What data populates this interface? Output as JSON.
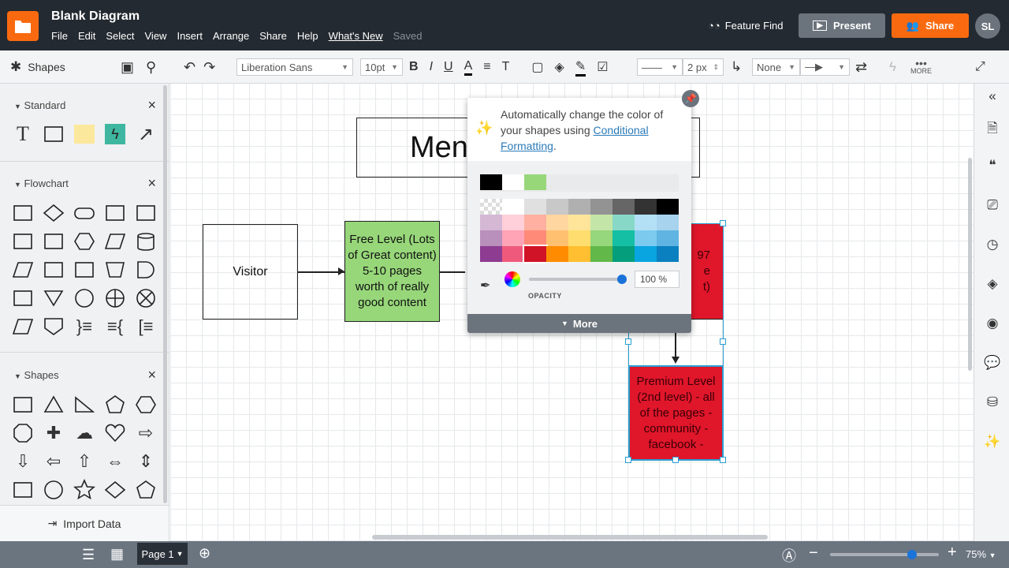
{
  "app": {
    "title": "Blank Diagram",
    "menu": [
      "File",
      "Edit",
      "Select",
      "View",
      "Insert",
      "Arrange",
      "Share",
      "Help"
    ],
    "whats_new": "What's New",
    "saved": "Saved",
    "feature_find": "Feature Find",
    "present": "Present",
    "share": "Share",
    "avatar": "SL",
    "brand_color": "#f96a10"
  },
  "toolbar": {
    "shapes_label": "Shapes",
    "font": "Liberation Sans",
    "font_size": "10pt",
    "line_width": "2 px",
    "line_start": "None",
    "more": "MORE"
  },
  "left": {
    "sections": [
      {
        "title": "Standard",
        "shapes": [
          "text-icon",
          "rectangle-icon",
          "note-icon",
          "action-icon",
          "arrow-line-icon"
        ]
      },
      {
        "title": "Flowchart",
        "shapes": [
          "process-icon",
          "decision-icon",
          "terminator-icon",
          "predefined-process-icon",
          "document-icon",
          "internal-storage-icon",
          "manual-input-icon",
          "preparation-icon",
          "data-icon",
          "database-icon",
          "direct-data-icon",
          "display-icon",
          "tape-icon",
          "manual-operation-icon",
          "delay-icon",
          "card-icon",
          "merge-icon",
          "connector-icon",
          "or-icon",
          "summing-junction-icon",
          "stored-data-icon",
          "off-page-icon",
          "brace-note-icon",
          "brace-icon",
          "annotation-icon"
        ]
      },
      {
        "title": "Shapes",
        "shapes": [
          "rectangle-icon",
          "triangle-icon",
          "right-triangle-icon",
          "pentagon-icon",
          "hexagon-icon",
          "octagon-icon",
          "cross-icon",
          "cloud-icon",
          "heart-icon",
          "arrow-right-icon",
          "arrow-down-icon",
          "arrow-left-icon",
          "arrow-up-icon",
          "arrow-left-right-icon",
          "arrow-up-down-icon",
          "callout-icon",
          "circle-icon",
          "star-icon",
          "diamond-icon",
          "badge-icon"
        ]
      }
    ],
    "import": "Import Data"
  },
  "canvas": {
    "title_text": "Men",
    "visitor": "Visitor",
    "free_level": "Free Level (Lots of Great content) 5-10 pages worth of really good content",
    "paid_partial": [
      "97",
      "e",
      "t)"
    ],
    "premium": "Premium Level (2nd level) - all of the pages - community - facebook -"
  },
  "popover": {
    "msg": "Automatically change the color of your shapes using ",
    "link": "Conditional Formatting",
    "period": ".",
    "recent": [
      "#000000",
      "#ffffff",
      "#97d77a"
    ],
    "palette": [
      [
        "transparent",
        "#ffffff",
        "#e0e0e0",
        "#c8c8c8",
        "#b0b0b0",
        "#939393",
        "#666666",
        "#333333",
        "#000000"
      ],
      [
        "#d4b8d4",
        "#ffd0d9",
        "#ffb0a0",
        "#ffd6a0",
        "#ffe59a",
        "#c3e6a8",
        "#88d8c8",
        "#b3e0f5",
        "#a7d3ee"
      ],
      [
        "#b98fbc",
        "#ffa3b7",
        "#ff8a78",
        "#ffc070",
        "#ffdd6e",
        "#96d67c",
        "#14bfa4",
        "#7ccbef",
        "#5fb4e1"
      ],
      [
        "#8d3c91",
        "#ef5a7c",
        "#d11327",
        "#ff8c00",
        "#ffbf30",
        "#62b849",
        "#049e7c",
        "#08a5e0",
        "#0a80c0"
      ]
    ],
    "selected": "#d11327",
    "opacity": "100 %",
    "opacity_value": 100,
    "opacity_label": "OPACITY",
    "more": "More"
  },
  "bottom": {
    "page": "Page 1",
    "zoom": "75%",
    "zoom_value": 75
  }
}
